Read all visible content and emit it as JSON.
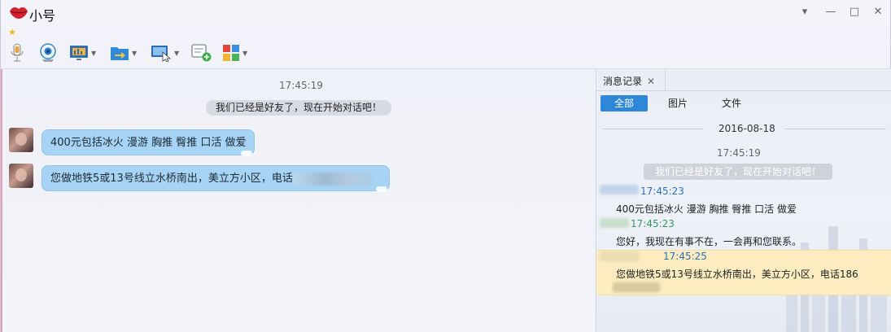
{
  "window": {
    "title": "小号",
    "controls": [
      "▾",
      "—",
      "□",
      "✕"
    ]
  },
  "toolbar": {
    "items": [
      {
        "icon": "microphone-icon"
      },
      {
        "icon": "webcam-icon"
      },
      {
        "icon": "screen-share-icon"
      },
      {
        "icon": "file-transfer-icon"
      },
      {
        "icon": "remote-desktop-icon"
      },
      {
        "icon": "add-message-icon"
      },
      {
        "icon": "apps-grid-icon"
      }
    ]
  },
  "chat": {
    "time": "17:45:19",
    "system_message": "我们已经是好友了，现在开始对话吧！",
    "messages": [
      {
        "text": "400元包括冰火 漫游 胸推 臀推 口活 做爱"
      },
      {
        "text": "您做地铁5或13号线立水桥南出，美立方小区，电话"
      }
    ]
  },
  "history": {
    "tab_label": "消息记录",
    "tab_close": "✕",
    "filters": {
      "all": "全部",
      "images": "图片",
      "files": "文件"
    },
    "date": "2016-08-18",
    "time": "17:45:19",
    "system_message": "我们已经是好友了，现在开始对话吧！",
    "entries": [
      {
        "time": "17:45:23",
        "text": "400元包括冰火 漫游 胸推 臀推 口活 做爱"
      },
      {
        "time": "17:45:23",
        "text": "您好，我现在有事不在，一会再和您联系。"
      },
      {
        "time": "17:45:25",
        "text": "您做地铁5或13号线立水桥南出，美立方小区，电话186"
      }
    ]
  },
  "colors": {
    "bubble": "#a7d4f5",
    "accent": "#2f87d7",
    "highlight": "#fcecbf",
    "time_blue": "#2d6fb8",
    "time_green": "#2f9b5f"
  }
}
